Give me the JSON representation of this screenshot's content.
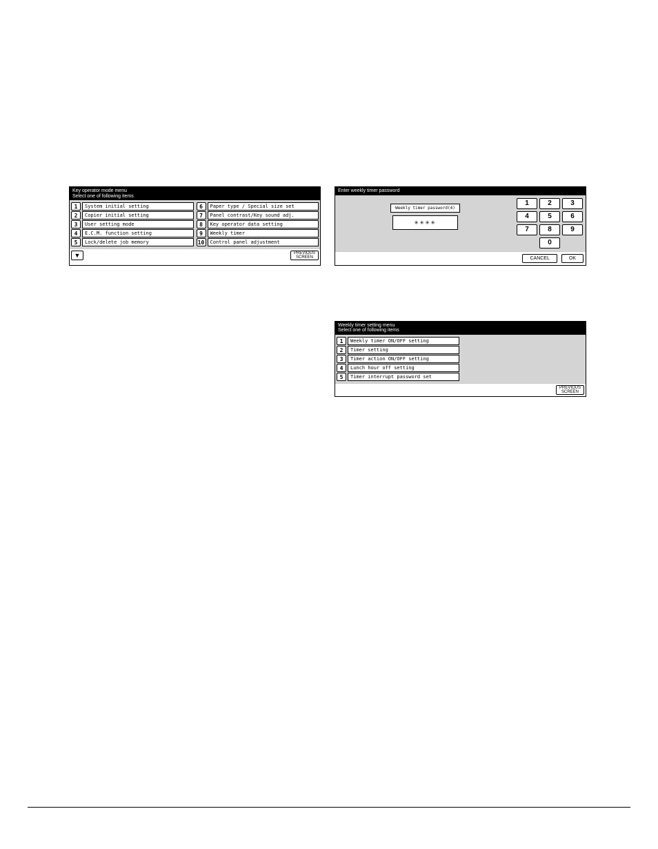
{
  "panel1": {
    "header_line1": "Key operator mode menu",
    "header_line2": "Select one of following items",
    "left": [
      {
        "n": "1",
        "label": "System initial setting"
      },
      {
        "n": "2",
        "label": "Copier initial setting"
      },
      {
        "n": "3",
        "label": "User setting mode"
      },
      {
        "n": "4",
        "label": "E.C.M. function setting"
      },
      {
        "n": "5",
        "label": "Lock/delete job memory"
      }
    ],
    "right": [
      {
        "n": "6",
        "label": "Paper type / Special size set"
      },
      {
        "n": "7",
        "label": "Panel contrast/Key sound adj."
      },
      {
        "n": "8",
        "label": "Key operator data setting"
      },
      {
        "n": "9",
        "label": "Weekly timer"
      },
      {
        "n": "10",
        "label": "Control panel adjustment"
      }
    ],
    "prev1": "PREVIOUS",
    "prev2": "SCREEN"
  },
  "panel2": {
    "header": "Enter weekly timer password",
    "label": "Weekly timer password(4)",
    "value": "✳✳✳✳",
    "keys": [
      "1",
      "2",
      "3",
      "4",
      "5",
      "6",
      "7",
      "8",
      "9",
      "0"
    ],
    "cancel": "CANCEL",
    "ok": "OK"
  },
  "panel3": {
    "header_line1": "Weekly timer setting menu",
    "header_line2": "Select one of following items",
    "items": [
      {
        "n": "1",
        "label": "Weekly timer ON/OFF setting"
      },
      {
        "n": "2",
        "label": "Timer setting"
      },
      {
        "n": "3",
        "label": "Timer action ON/OFF setting"
      },
      {
        "n": "4",
        "label": "Lunch hour off setting"
      },
      {
        "n": "5",
        "label": "Timer interrupt password set"
      }
    ],
    "prev1": "PREVIOUS",
    "prev2": "SCREEN"
  }
}
